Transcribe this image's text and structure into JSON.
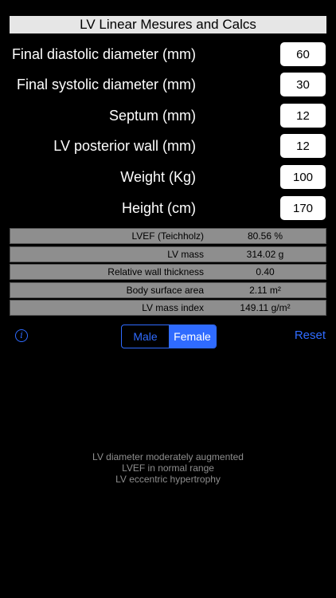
{
  "title": "LV Linear Mesures and Calcs",
  "fields": [
    {
      "label": "Final diastolic diameter (mm)",
      "value": "60"
    },
    {
      "label": "Final systolic diameter (mm)",
      "value": "30"
    },
    {
      "label": "Septum (mm)",
      "value": "12"
    },
    {
      "label": "LV posterior wall (mm)",
      "value": "12"
    },
    {
      "label": "Weight (Kg)",
      "value": "100"
    },
    {
      "label": "Height (cm)",
      "value": "170"
    }
  ],
  "results": [
    {
      "label": "LVEF (Teichholz)",
      "value": "80.56 %"
    },
    {
      "label": "LV mass",
      "value": "314.02 g"
    },
    {
      "label": "Relative wall thickness",
      "value": "0.40"
    },
    {
      "label": "Body surface area",
      "value": "2.11 m²"
    },
    {
      "label": "LV mass index",
      "value": "149.11 g/m²"
    }
  ],
  "controls": {
    "info_icon": "info-icon",
    "sex": {
      "options": [
        "Male",
        "Female"
      ],
      "selected": "Female"
    },
    "reset_label": "Reset",
    "accent_color": "#2f6bff"
  },
  "messages": [
    "LV diameter moderately augmented",
    "LVEF in normal range",
    "LV eccentric hypertrophy"
  ]
}
